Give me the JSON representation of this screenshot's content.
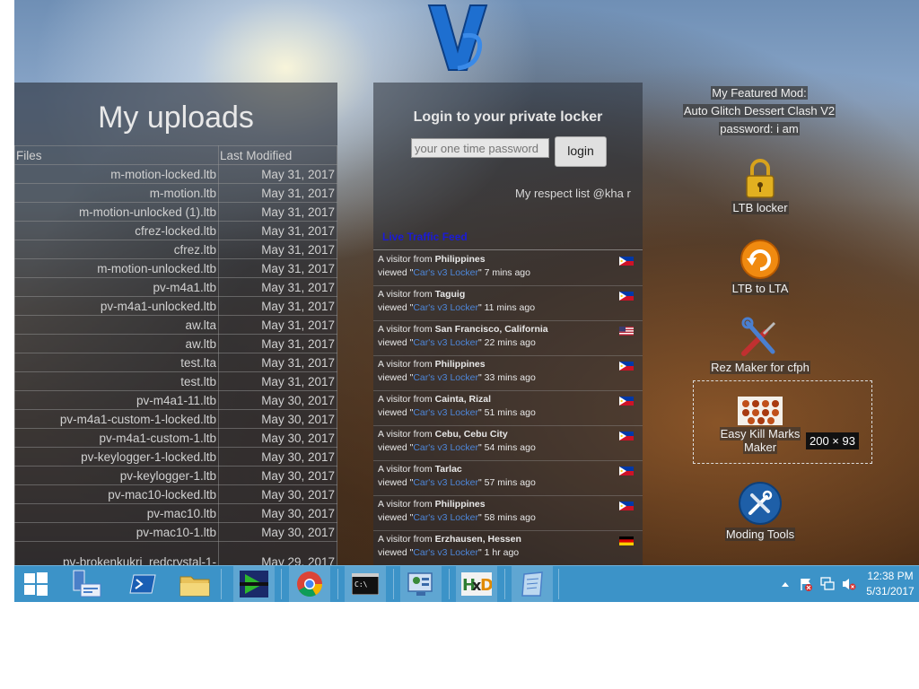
{
  "uploads": {
    "title": "My uploads",
    "columns": [
      "Files",
      "Last Modified"
    ],
    "rows": [
      {
        "file": "m-motion-locked.ltb",
        "date": "May 31, 2017"
      },
      {
        "file": "m-motion.ltb",
        "date": "May 31, 2017"
      },
      {
        "file": "m-motion-unlocked (1).ltb",
        "date": "May 31, 2017"
      },
      {
        "file": "cfrez-locked.ltb",
        "date": "May 31, 2017"
      },
      {
        "file": "cfrez.ltb",
        "date": "May 31, 2017"
      },
      {
        "file": "m-motion-unlocked.ltb",
        "date": "May 31, 2017"
      },
      {
        "file": "pv-m4a1.ltb",
        "date": "May 31, 2017"
      },
      {
        "file": "pv-m4a1-unlocked.ltb",
        "date": "May 31, 2017"
      },
      {
        "file": "aw.lta",
        "date": "May 31, 2017"
      },
      {
        "file": "aw.ltb",
        "date": "May 31, 2017"
      },
      {
        "file": "test.lta",
        "date": "May 31, 2017"
      },
      {
        "file": "test.ltb",
        "date": "May 31, 2017"
      },
      {
        "file": "pv-m4a1-11.ltb",
        "date": "May 30, 2017"
      },
      {
        "file": "pv-m4a1-custom-1-locked.ltb",
        "date": "May 30, 2017"
      },
      {
        "file": "pv-m4a1-custom-1.ltb",
        "date": "May 30, 2017"
      },
      {
        "file": "pv-keylogger-1-locked.ltb",
        "date": "May 30, 2017"
      },
      {
        "file": "pv-keylogger-1.ltb",
        "date": "May 30, 2017"
      },
      {
        "file": "pv-mac10-locked.ltb",
        "date": "May 30, 2017"
      },
      {
        "file": "pv-mac10.ltb",
        "date": "May 30, 2017"
      },
      {
        "file": "pv-mac10-1.ltb",
        "date": "May 30, 2017"
      },
      {
        "file": "pv-brokenkukri_redcrystal-1-",
        "date": "May 29, 2017"
      }
    ]
  },
  "login": {
    "title": "Login to your private locker",
    "placeholder": "your one time password",
    "button": "login",
    "respect": "My respect list @kha r"
  },
  "feed": {
    "title": "Live Traffic Feed",
    "prefix": "A visitor from ",
    "viewed": "viewed \"",
    "link": "Car's v3 Locker",
    "items": [
      {
        "place": "Philippines",
        "time": "\" 7 mins ago",
        "flag": "ph"
      },
      {
        "place": "Taguig",
        "time": "\" 11 mins ago",
        "flag": "ph"
      },
      {
        "place": "San Francisco, California",
        "time": "\" 22 mins ago",
        "flag": "us"
      },
      {
        "place": "Philippines",
        "time": "\" 33 mins ago",
        "flag": "ph"
      },
      {
        "place": "Cainta, Rizal",
        "time": "\" 51 mins ago",
        "flag": "ph"
      },
      {
        "place": "Cebu, Cebu City",
        "time": "\" 54 mins ago",
        "flag": "ph"
      },
      {
        "place": "Tarlac",
        "time": "\" 57 mins ago",
        "flag": "ph"
      },
      {
        "place": "Philippines",
        "time": "\" 58 mins ago",
        "flag": "ph"
      },
      {
        "place": "Erzhausen, Hessen",
        "time": "\" 1 hr ago",
        "flag": "de"
      }
    ]
  },
  "featured": {
    "line1": "My Featured Mod:",
    "line2": "Auto Glitch Dessert Clash V2",
    "line3": "password: i am"
  },
  "desktop_icons": {
    "ltb_locker": "LTB locker",
    "ltb_to_lta": "LTB to LTA",
    "rez_maker": "Rez Maker for cfph",
    "kill_marks_1": "Easy Kill Marks",
    "kill_marks_2": "Maker",
    "moding_tools": "Moding Tools"
  },
  "selection_size": "200 × 93",
  "taskbar": {
    "items": [
      "start-button",
      "server-manager-icon",
      "powershell-icon",
      "file-explorer-icon",
      "media-app-icon",
      "chrome-icon",
      "cmd-icon",
      "control-panel-icon",
      "hxd-icon",
      "notepad-icon"
    ],
    "time": "12:38 PM",
    "date": "5/31/2017"
  },
  "colors": {
    "taskbar": "#3c93c8",
    "feed_title": "#1b1bd6",
    "feed_link": "#4d86d8"
  }
}
